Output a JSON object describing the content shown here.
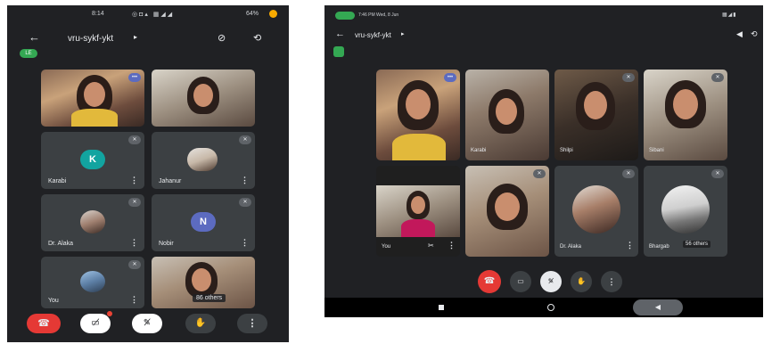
{
  "phone": {
    "status_bar": {
      "time": "8:14",
      "battery": "64%"
    },
    "meeting_title": "vru-sykf-ykt",
    "live_badge": "LE",
    "tiles": [
      {
        "kind": "video"
      },
      {
        "kind": "video"
      },
      {
        "kind": "avatar",
        "initial": "K",
        "name": "Karabi",
        "color": "#12a4a0"
      },
      {
        "kind": "photo",
        "name": "Jahanur"
      },
      {
        "kind": "photo",
        "name": "Dr. Alaka"
      },
      {
        "kind": "avatar",
        "initial": "N",
        "name": "Nobir",
        "color": "#5c6bc0"
      },
      {
        "kind": "photo",
        "name": "You"
      },
      {
        "kind": "video",
        "overlay": "86 others"
      }
    ],
    "colors": {
      "end_call": "#e53935",
      "background": "#202124"
    }
  },
  "tablet": {
    "status_bar": {
      "time": "7:46 PM Wed, 8 Jun"
    },
    "meeting_title": "vru-sykf-ykt",
    "tiles": [
      {
        "name": ""
      },
      {
        "name": "Karabi"
      },
      {
        "name": "Shilpi"
      },
      {
        "name": "Sibani"
      },
      {
        "name": "You"
      },
      {
        "name": ""
      },
      {
        "name": "Dr. Alaka"
      },
      {
        "name": "Bhargab",
        "overlay": "56 others"
      }
    ],
    "colors": {
      "end_call": "#e53935",
      "active_control": "#e8eaed"
    }
  }
}
